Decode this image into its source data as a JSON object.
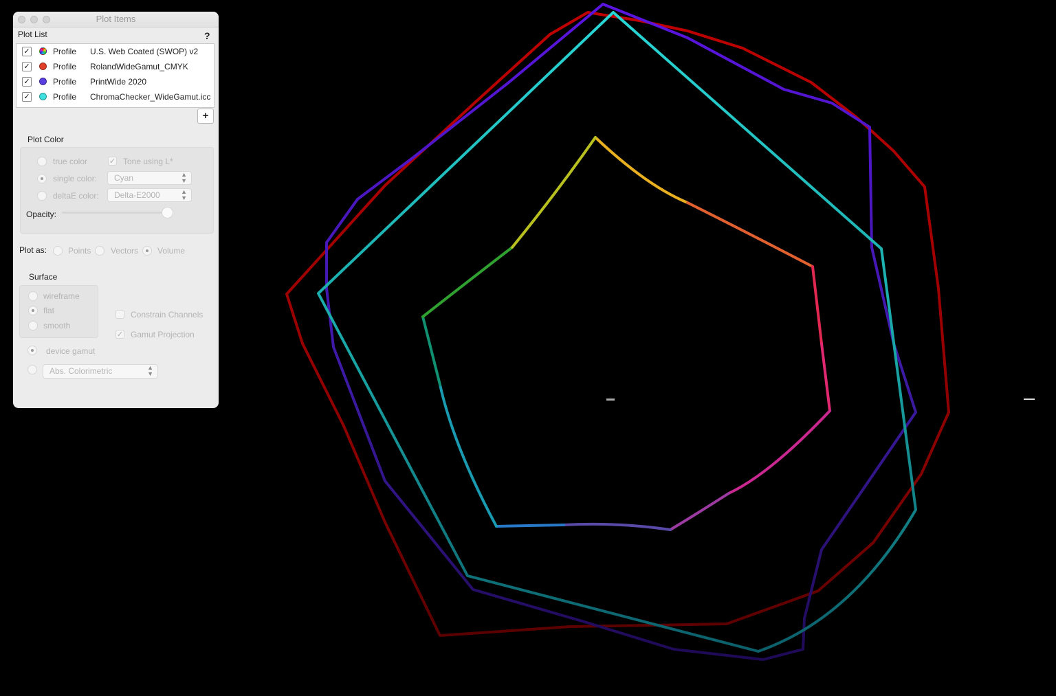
{
  "window": {
    "title": "Plot Items"
  },
  "plot_list": {
    "label": "Plot List",
    "help": "?",
    "add_button": "+",
    "items": [
      {
        "kind": "Profile",
        "name": "U.S. Web Coated (SWOP) v2",
        "checked": true,
        "swatch": "multicolor"
      },
      {
        "kind": "Profile",
        "name": "RolandWideGamut_CMYK",
        "checked": true,
        "swatch": "#e0402a"
      },
      {
        "kind": "Profile",
        "name": "PrintWide 2020",
        "checked": true,
        "swatch": "#5a3fe0"
      },
      {
        "kind": "Profile",
        "name": "ChromaChecker_WideGamut.icc",
        "checked": true,
        "swatch": "#3fe0e0"
      }
    ]
  },
  "plot_color": {
    "label": "Plot Color",
    "true_color": "true color",
    "tone_using": "Tone using L*",
    "single_color": "single color:",
    "single_color_value": "Cyan",
    "deltae_color": "deltaE color:",
    "deltae_value": "Delta-E2000",
    "opacity_label": "Opacity:",
    "opacity": 0.95
  },
  "plot_as": {
    "label": "Plot as:",
    "options": [
      "Points",
      "Vectors",
      "Volume"
    ],
    "selected": "Volume"
  },
  "surface": {
    "label": "Surface",
    "options": [
      "wireframe",
      "flat",
      "smooth"
    ],
    "selected": "flat",
    "constrain_channels": "Constrain Channels",
    "gamut_projection": "Gamut Projection",
    "device_gamut": "device gamut",
    "intent_value": "Abs. Colorimetric"
  },
  "colors": {
    "swop": "gradient",
    "roland": "#9a0000",
    "printwide": "#4a14c0",
    "chromachecker": "#1ec8c8"
  }
}
